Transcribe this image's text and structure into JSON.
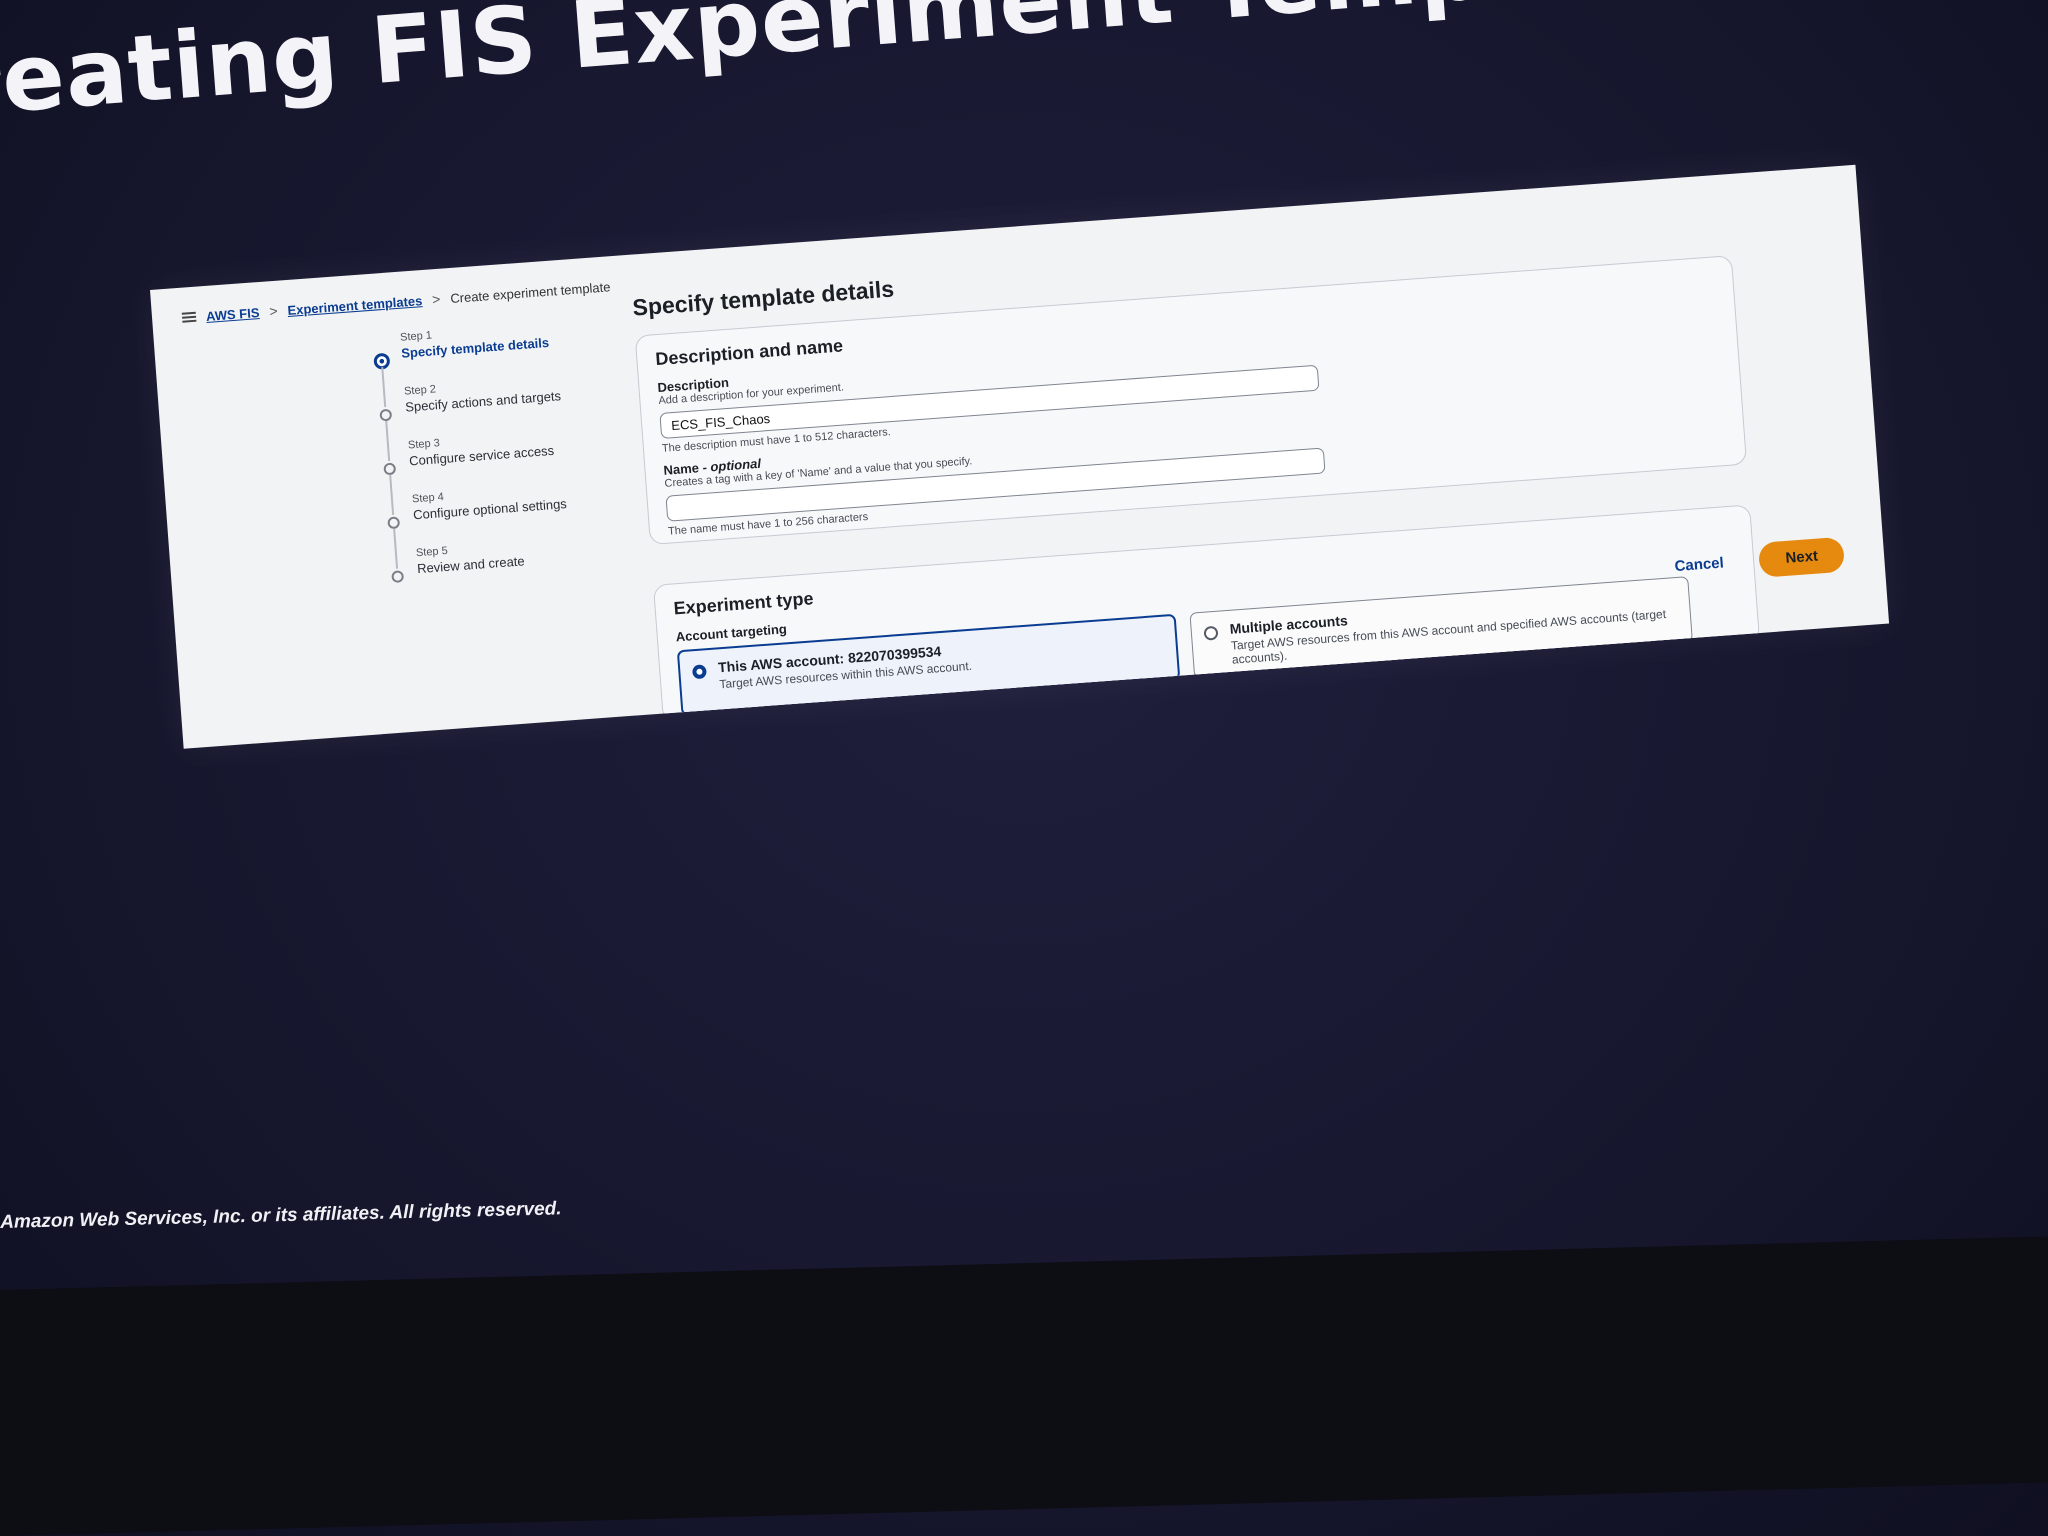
{
  "slide": {
    "title": "reating FIS Experiment Template",
    "copyright": "Amazon Web Services, Inc. or its affiliates. All rights reserved."
  },
  "breadcrumb": {
    "items": [
      "AWS FIS",
      "Experiment templates"
    ],
    "current": "Create experiment template",
    "separator": ">"
  },
  "steps": [
    {
      "num": "Step 1",
      "label": "Specify template details",
      "active": true
    },
    {
      "num": "Step 2",
      "label": "Specify actions and targets"
    },
    {
      "num": "Step 3",
      "label": "Configure service access"
    },
    {
      "num": "Step 4",
      "label": "Configure optional settings"
    },
    {
      "num": "Step 5",
      "label": "Review and create"
    }
  ],
  "page_title": "Specify template details",
  "description_panel": {
    "title": "Description and name",
    "description": {
      "label": "Description",
      "hint": "Add a description for your experiment.",
      "value": "ECS_FIS_Chaos",
      "constraint": "The description must have 1 to 512 characters."
    },
    "name": {
      "label": "Name - ",
      "label_optional": "optional",
      "hint": "Creates a tag with a key of 'Name' and a value that you specify.",
      "value": "",
      "constraint": "The name must have 1 to 256 characters"
    }
  },
  "experiment_type": {
    "title": "Experiment type",
    "account_targeting_label": "Account targeting",
    "options": [
      {
        "title": "This AWS account: 822070399534",
        "desc": "Target AWS resources within this AWS account.",
        "selected": true
      },
      {
        "title": "Multiple accounts",
        "desc": "Target AWS resources from this AWS account and specified AWS accounts (target accounts).",
        "selected": false
      }
    ]
  },
  "actions": {
    "cancel": "Cancel",
    "next": "Next"
  },
  "colors": {
    "accent": "#0a3d91",
    "primary_button": "#e68a0f",
    "background": "#17172f"
  }
}
